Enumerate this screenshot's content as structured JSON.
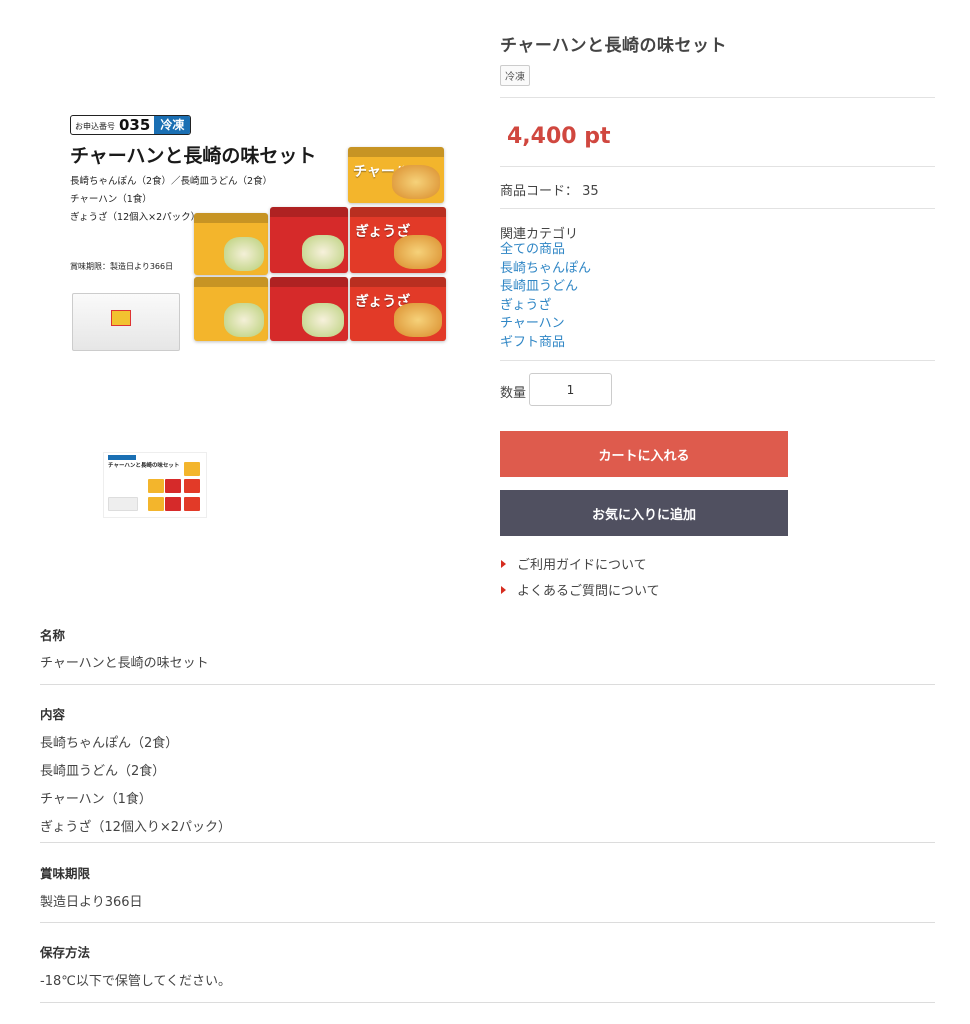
{
  "product": {
    "title": "チャーハンと長崎の味セット",
    "tag": "冷凍",
    "price": "4,400 pt",
    "code_label": "商品コード：",
    "code_value": "35",
    "related_label": "関連カテゴリ",
    "categories": [
      "全ての商品",
      "長崎ちゃんぽん",
      "長崎皿うどん",
      "ぎょうざ",
      "チャーハン",
      "ギフト商品"
    ],
    "quantity_label": "数量",
    "quantity_value": "1",
    "add_to_cart": "カートに入れる",
    "add_to_favorites": "お気に入りに追加",
    "links": [
      "ご利用ガイドについて",
      "よくあるご質問について"
    ]
  },
  "poster": {
    "order_label": "お申込番号",
    "order_number": "035",
    "frozen_badge": "冷凍",
    "title": "チャーハンと長崎の味セット",
    "lines": [
      "長崎ちゃんぽん（2食）／長崎皿うどん（2食）",
      "チャーハン（1食）",
      "ぎょうざ（12個入×2パック）"
    ],
    "best_before": "賞味期限：製造日より366日",
    "packs": [
      "チャーハン",
      "長崎ちゃんぽん",
      "長崎皿うどん",
      "ぎょうざ"
    ]
  },
  "details": [
    {
      "heading": "名称",
      "lines": [
        "チャーハンと長崎の味セット"
      ]
    },
    {
      "heading": "内容",
      "lines": [
        "長崎ちゃんぽん（2食）",
        "長崎皿うどん（2食）",
        "チャーハン（1食）",
        "ぎょうざ（12個入り×2パック）"
      ]
    },
    {
      "heading": "賞味期限",
      "lines": [
        "製造日より366日"
      ]
    },
    {
      "heading": "保存方法",
      "lines": [
        "-18℃以下で保管してください。"
      ]
    }
  ],
  "colors": {
    "price": "#d0473f",
    "cart_button": "#de5b4d",
    "favorite_button": "#505060",
    "link": "#2f86c5",
    "arrow": "#d62d20"
  }
}
